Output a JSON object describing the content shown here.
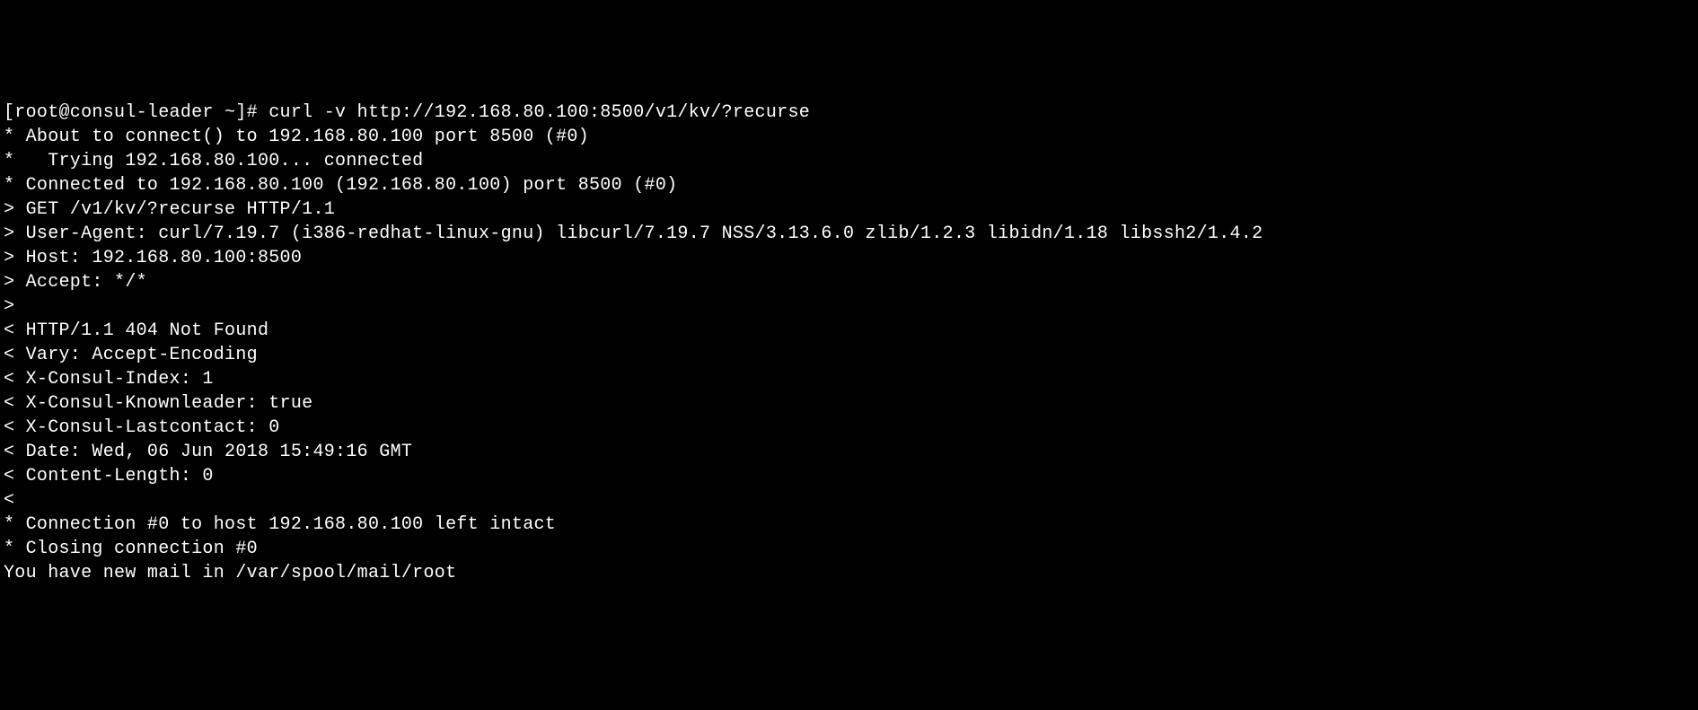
{
  "terminal": {
    "prompt": "[root@consul-leader ~]# ",
    "command": "curl -v http://192.168.80.100:8500/v1/kv/?recurse",
    "lines": [
      "* About to connect() to 192.168.80.100 port 8500 (#0)",
      "*   Trying 192.168.80.100... connected",
      "* Connected to 192.168.80.100 (192.168.80.100) port 8500 (#0)",
      "> GET /v1/kv/?recurse HTTP/1.1",
      "> User-Agent: curl/7.19.7 (i386-redhat-linux-gnu) libcurl/7.19.7 NSS/3.13.6.0 zlib/1.2.3 libidn/1.18 libssh2/1.4.2",
      "> Host: 192.168.80.100:8500",
      "> Accept: */*",
      ">",
      "< HTTP/1.1 404 Not Found",
      "< Vary: Accept-Encoding",
      "< X-Consul-Index: 1",
      "< X-Consul-Knownleader: true",
      "< X-Consul-Lastcontact: 0",
      "< Date: Wed, 06 Jun 2018 15:49:16 GMT",
      "< Content-Length: 0",
      "<",
      "* Connection #0 to host 192.168.80.100 left intact",
      "* Closing connection #0",
      "You have new mail in /var/spool/mail/root"
    ]
  }
}
